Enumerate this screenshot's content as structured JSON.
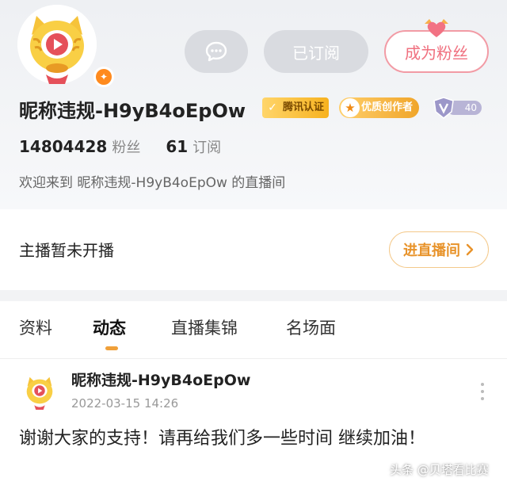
{
  "profile": {
    "nickname": "昵称违规-H9yB4oEpOw",
    "badges": {
      "tencent_verified": "腾讯认证",
      "quality_creator": "优质创作者",
      "level": "40"
    },
    "stats": {
      "fans_count": "14804428",
      "fans_label": "粉丝",
      "subs_count": "61",
      "subs_label": "订阅"
    },
    "welcome_text": "欢迎来到 昵称违规-H9yB4oEpOw 的直播间"
  },
  "actions": {
    "subscribed_label": "已订阅",
    "become_fan_label": "成为粉丝"
  },
  "live": {
    "status_text": "主播暂未开播",
    "enter_label": "进直播间"
  },
  "tabs": [
    {
      "label": "资料"
    },
    {
      "label": "动态"
    },
    {
      "label": "直播集锦"
    },
    {
      "label": "名场面"
    }
  ],
  "active_tab": "动态",
  "post": {
    "author": "昵称违规-H9yB4oEpOw",
    "time": "2022-03-15 14:26",
    "content": "谢谢大家的支持！请再给我们多一些时间 继续加油！"
  },
  "watermark": "头条 @贝塔看比赛",
  "colors": {
    "accent_orange": "#f0a03a",
    "fan_pink": "#f0707f",
    "button_gray": "#d9dbe0"
  },
  "icons": {
    "message": "message-bubble-icon",
    "heart": "heart-crown-icon",
    "chevron": "chevron-right-icon",
    "more": "more-vertical-icon"
  }
}
